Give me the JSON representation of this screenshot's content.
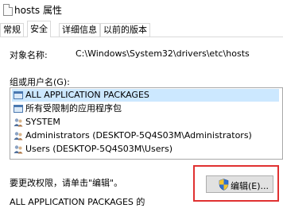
{
  "window": {
    "title": "hosts 属性"
  },
  "tabs": [
    {
      "label": "常规",
      "active": false
    },
    {
      "label": "安全",
      "active": true
    },
    {
      "label": "详细信息",
      "active": false
    },
    {
      "label": "以前的版本",
      "active": false
    }
  ],
  "security": {
    "object_name_label": "对象名称:",
    "object_name_value": "C:\\Windows\\System32\\drivers\\etc\\hosts",
    "groups_label": "组或用户名(G):",
    "groups": [
      {
        "label": "ALL APPLICATION PACKAGES",
        "icon": "app-package-icon",
        "selected": true
      },
      {
        "label": "所有受限制的应用程序包",
        "icon": "app-package-icon",
        "selected": false
      },
      {
        "label": "SYSTEM",
        "icon": "users-icon",
        "selected": false
      },
      {
        "label": "Administrators (DESKTOP-5Q4S03M\\Administrators)",
        "icon": "users-icon",
        "selected": false
      },
      {
        "label": "Users (DESKTOP-5Q4S03M\\Users)",
        "icon": "users-icon",
        "selected": false
      }
    ],
    "change_prompt": "要更改权限，请单击\"编辑\"。",
    "edit_button_label": "编辑(E)...",
    "permissions_for": "ALL APPLICATION PACKAGES 的"
  },
  "colors": {
    "selection": "#cce8ff",
    "highlight_border": "#e03131"
  }
}
